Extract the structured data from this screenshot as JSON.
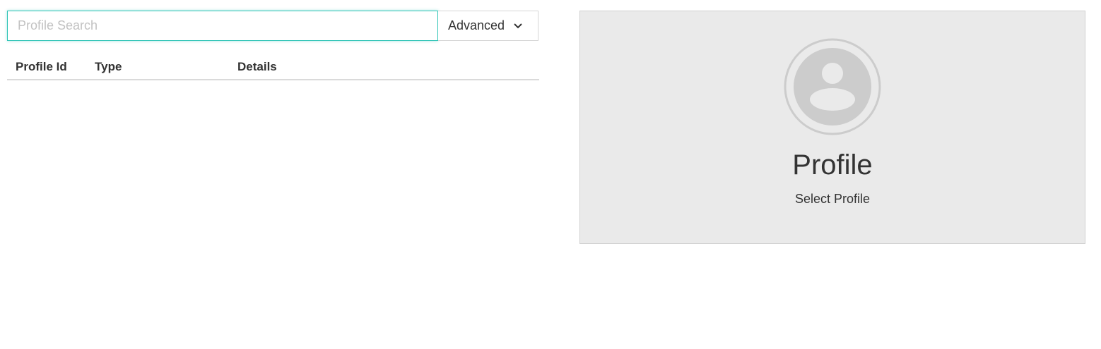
{
  "search": {
    "placeholder": "Profile Search",
    "value": ""
  },
  "advanced": {
    "label": "Advanced",
    "icon": "chevron-down-icon"
  },
  "table": {
    "columns": [
      "Profile Id",
      "Type",
      "Details"
    ],
    "rows": []
  },
  "profile_card": {
    "icon": "user-avatar-icon",
    "title": "Profile",
    "subtitle": "Select Profile",
    "background": "#eaeaea"
  },
  "colors": {
    "accent": "#2ec4b6",
    "avatar": "#cccccc"
  }
}
